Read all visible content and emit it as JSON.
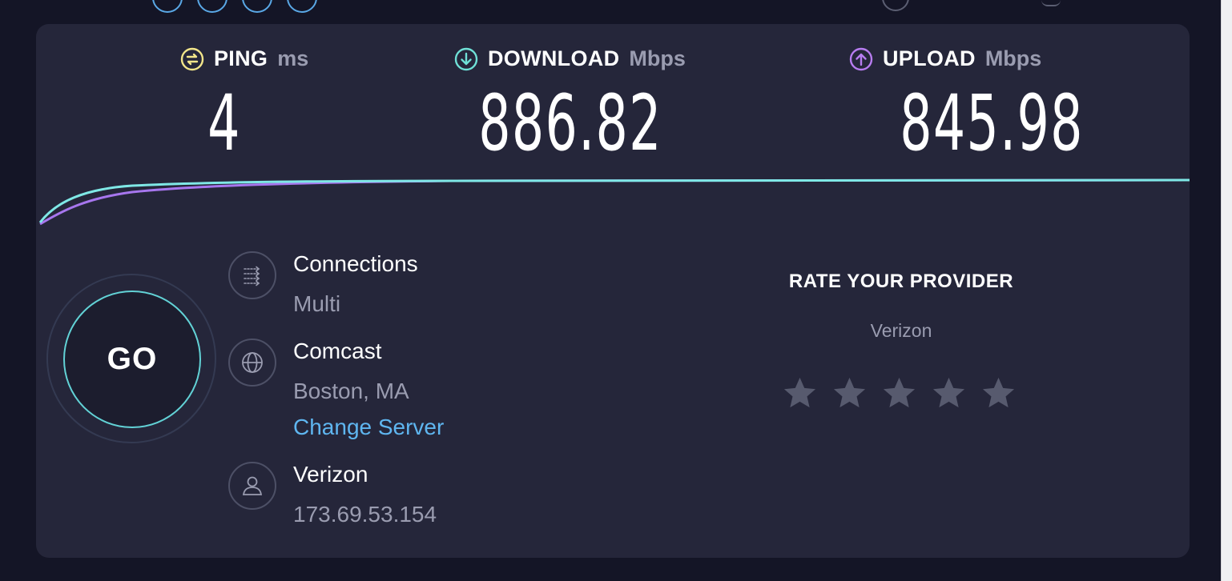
{
  "metrics": {
    "ping": {
      "label": "PING",
      "unit": "ms",
      "value": "4",
      "color": "#f2e58a",
      "icon": "ping-icon"
    },
    "download": {
      "label": "DOWNLOAD",
      "unit": "Mbps",
      "value": "886.82",
      "color": "#6fe0d6",
      "icon": "download-arrow-icon"
    },
    "upload": {
      "label": "UPLOAD",
      "unit": "Mbps",
      "value": "845.98",
      "color": "#b77cf0",
      "icon": "upload-arrow-icon"
    }
  },
  "go_button": {
    "label": "GO",
    "ring_color": "#62d2d6"
  },
  "details": {
    "connections": {
      "title": "Connections",
      "value": "Multi",
      "icon": "connections-icon"
    },
    "server": {
      "title": "Comcast",
      "location": "Boston, MA",
      "change_label": "Change Server",
      "icon": "globe-icon",
      "link_color": "#5fb6f0"
    },
    "provider": {
      "title": "Verizon",
      "ip": "173.69.53.154",
      "icon": "user-icon"
    }
  },
  "rating": {
    "title": "RATE YOUR PROVIDER",
    "provider": "Verizon",
    "stars": 5,
    "selected": 0
  },
  "colors": {
    "background": "#141526",
    "card": "#25263a",
    "download_line": "#7fe8e6",
    "upload_line": "#a776ee"
  }
}
